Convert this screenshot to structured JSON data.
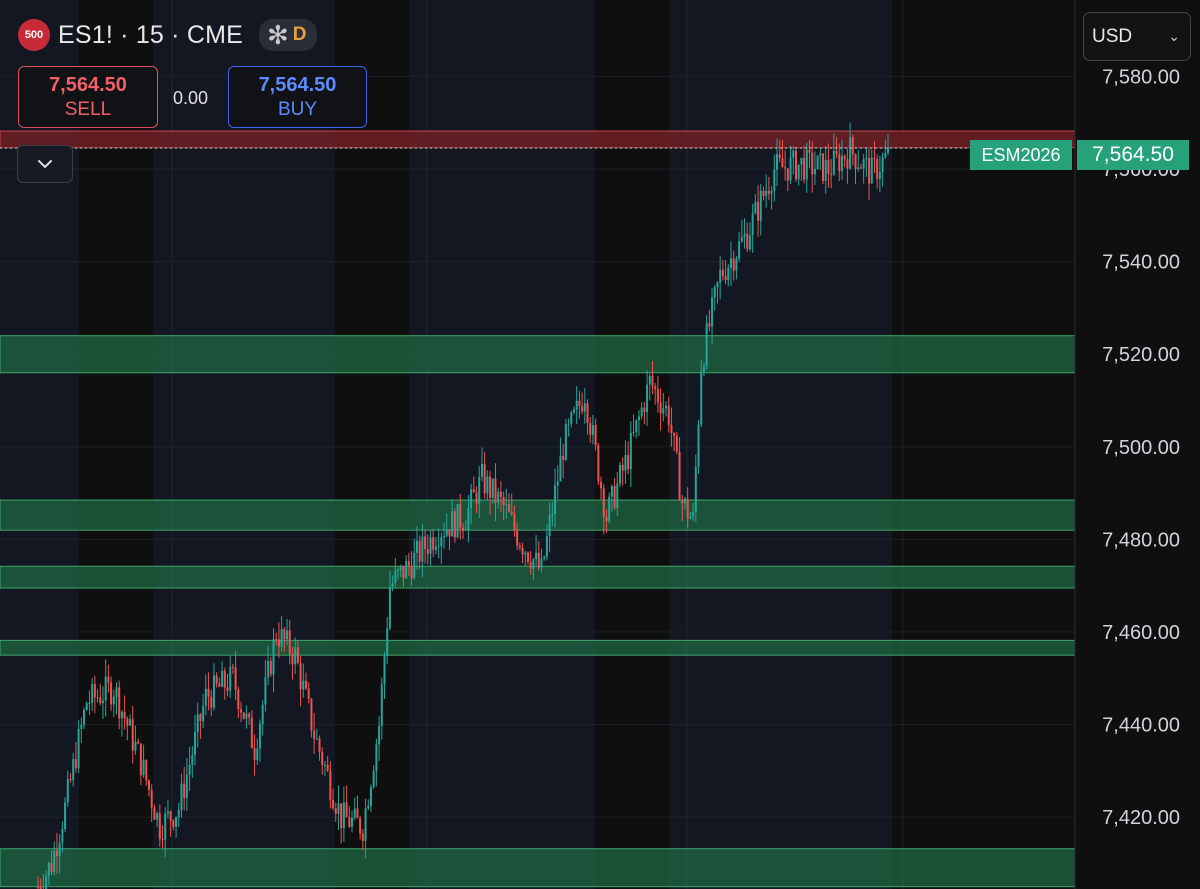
{
  "header": {
    "badge": "500",
    "symbol_title": "ES1! · 15 · CME",
    "session_icon": "asterisk-icon",
    "flag_letter": "D"
  },
  "trade": {
    "sell_price": "7,564.50",
    "sell_label": "SELL",
    "spread": "0.00",
    "buy_price": "7,564.50",
    "buy_label": "BUY"
  },
  "currency": {
    "label": "USD",
    "icon": "chevron-down-icon"
  },
  "last_price": {
    "symbol": "ESM2026",
    "price": "7,564.50"
  },
  "colors": {
    "background": "#0f0f0f",
    "session_shade": "#131722",
    "up": "#26a69a",
    "down": "#ef5350",
    "zone_fill": "#1f6e45",
    "resistance_fill": "#6e1f23",
    "price_tag": "#26a17a"
  },
  "chart_data": {
    "type": "candlestick",
    "y_unit": "USD",
    "y_axis_labels": [
      "7,580.00",
      "7,560.00",
      "7,540.00",
      "7,520.00",
      "7,500.00",
      "7,480.00",
      "7,460.00",
      "7,440.00",
      "7,420.00"
    ],
    "y_ticks": [
      7580,
      7560,
      7540,
      7520,
      7500,
      7480,
      7460,
      7440,
      7420
    ],
    "ylim": [
      7404.5,
      7596.5
    ],
    "last_price": 7564.5,
    "grid": true,
    "zones": [
      {
        "kind": "resistance",
        "low": 7564.6,
        "high": 7568.2
      },
      {
        "kind": "support",
        "low": 7516.0,
        "high": 7524.0
      },
      {
        "kind": "support",
        "low": 7482.0,
        "high": 7488.5
      },
      {
        "kind": "support",
        "low": 7469.5,
        "high": 7474.2
      },
      {
        "kind": "support",
        "low": 7455.0,
        "high": 7458.2
      },
      {
        "kind": "support",
        "low": 7405.0,
        "high": 7413.2
      }
    ],
    "waypoints": [
      [
        0,
        7405
      ],
      [
        5,
        7410
      ],
      [
        10,
        7422
      ],
      [
        18,
        7445
      ],
      [
        28,
        7448
      ],
      [
        38,
        7432
      ],
      [
        45,
        7418
      ],
      [
        52,
        7422
      ],
      [
        62,
        7446
      ],
      [
        72,
        7450
      ],
      [
        80,
        7435
      ],
      [
        88,
        7460
      ],
      [
        95,
        7455
      ],
      [
        102,
        7438
      ],
      [
        112,
        7420
      ],
      [
        120,
        7418
      ],
      [
        126,
        7440
      ],
      [
        130,
        7470
      ],
      [
        138,
        7475
      ],
      [
        148,
        7482
      ],
      [
        158,
        7485
      ],
      [
        164,
        7493
      ],
      [
        172,
        7487
      ],
      [
        178,
        7480
      ],
      [
        186,
        7473
      ],
      [
        194,
        7500
      ],
      [
        202,
        7512
      ],
      [
        210,
        7485
      ],
      [
        218,
        7498
      ],
      [
        226,
        7514
      ],
      [
        233,
        7507
      ],
      [
        238,
        7488
      ],
      [
        242,
        7484
      ],
      [
        245,
        7518
      ],
      [
        252,
        7537
      ],
      [
        262,
        7546
      ],
      [
        272,
        7560
      ],
      [
        282,
        7561
      ],
      [
        292,
        7560
      ],
      [
        300,
        7564
      ],
      [
        308,
        7559
      ],
      [
        314,
        7563
      ]
    ]
  }
}
